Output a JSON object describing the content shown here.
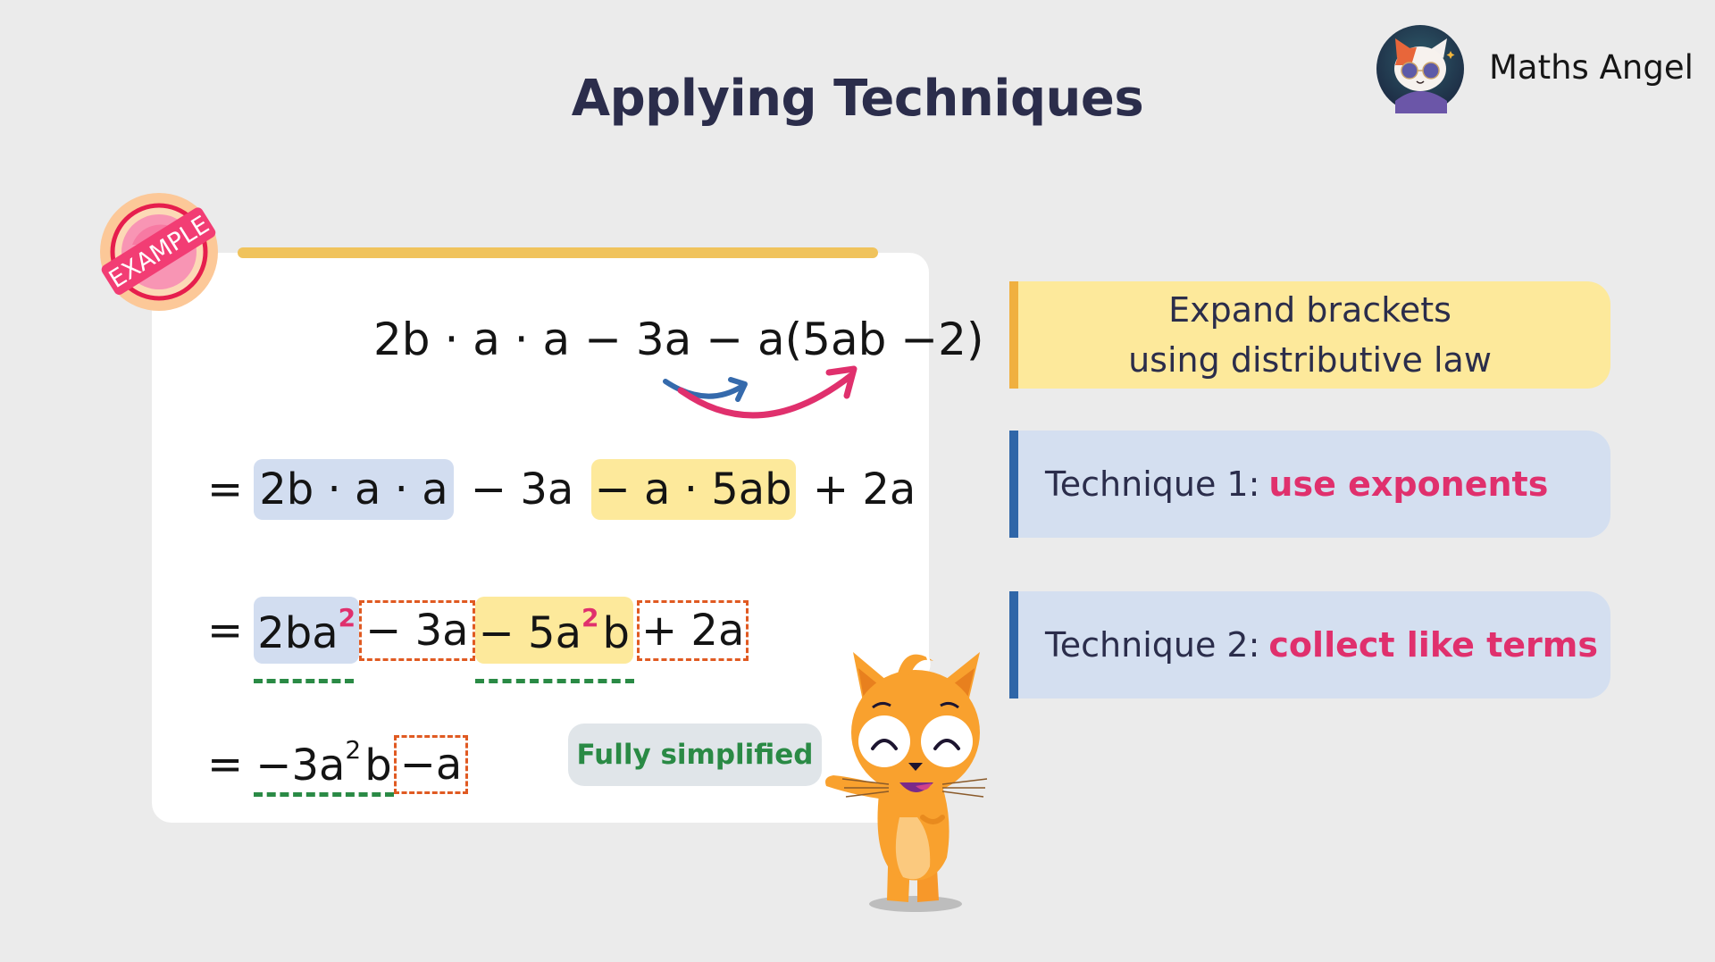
{
  "header": {
    "title": "Applying Techniques",
    "brand_name": "Maths Angel",
    "logo_icon": "cat-with-sunglasses-logo-icon"
  },
  "example_badge": {
    "label": "EXAMPLE"
  },
  "work": {
    "line1": {
      "expression": "2b · a · a − 3a − a(5ab −2)",
      "arrows": [
        "blue-arrow: a → 5ab",
        "pink-arrow: a → −2"
      ]
    },
    "line2": {
      "equals": "=",
      "terms": [
        {
          "text": "2b · a · a",
          "highlight": "blue"
        },
        {
          "text": " − 3a ",
          "highlight": "none"
        },
        {
          "text": "− a · 5ab",
          "highlight": "yellow"
        },
        {
          "text": " + 2a",
          "highlight": "none"
        }
      ]
    },
    "line3": {
      "equals": "=",
      "t1_base": "2ba",
      "t1_exp": "2",
      "t2": "− 3a",
      "t3_pre": "− 5a",
      "t3_exp": "2",
      "t3_post": "b",
      "t4": "+ 2a"
    },
    "line4": {
      "equals": "=",
      "t1_pre": "−3a",
      "t1_exp": "2",
      "t1_post": "b",
      "t2": "−a"
    },
    "status_pill": "Fully simplified"
  },
  "steps": [
    {
      "line1": "Expand brackets",
      "line2": "using distributive law"
    },
    {
      "prefix": "Technique 1:",
      "emphasis": "use exponents"
    },
    {
      "prefix": "Technique 2:",
      "emphasis": "collect like terms"
    }
  ],
  "colors": {
    "title": "#2b2d4b",
    "highlight_blue": "#d2ddf0",
    "highlight_yellow": "#fde99b",
    "accent_pink": "#e0306d",
    "dash_orange": "#e05a22",
    "underline_green": "#2a8a45",
    "step_bar_yellow": "#f0b040",
    "step_bar_blue": "#2f66a8"
  }
}
